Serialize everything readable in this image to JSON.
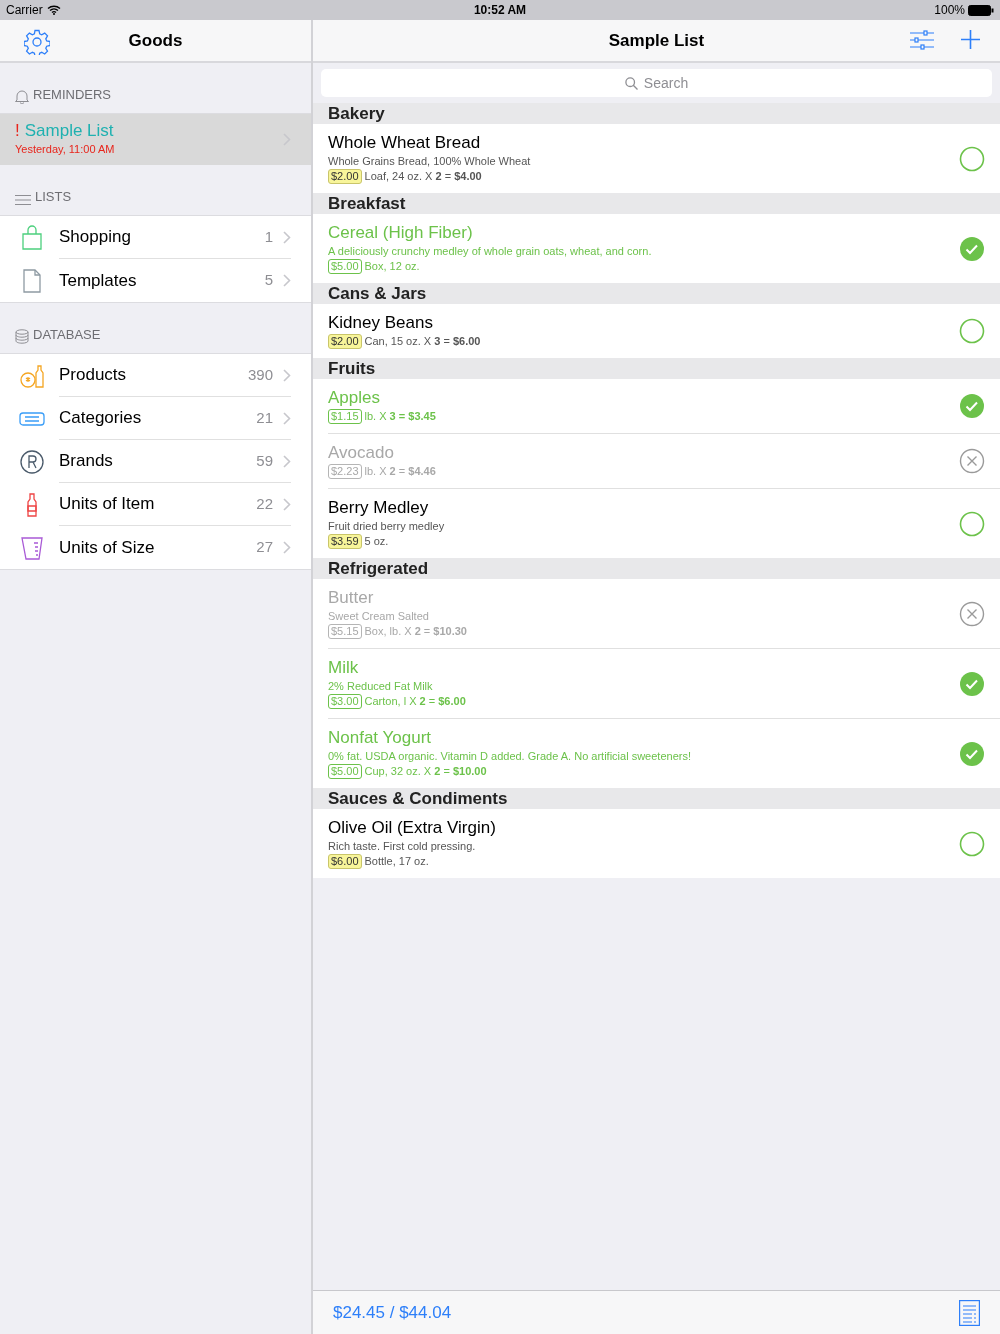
{
  "status_bar": {
    "carrier": "Carrier",
    "time": "10:52 AM",
    "battery": "100%"
  },
  "sidebar": {
    "title": "Goods",
    "reminders": {
      "header": "REMINDERS",
      "items": [
        {
          "mark": "!",
          "title": "Sample List",
          "time": "Yesterday, 11:00 AM",
          "selected": true
        }
      ]
    },
    "lists": {
      "header": "LISTS",
      "items": [
        {
          "kind": "shopping",
          "label": "Shopping",
          "count": "1"
        },
        {
          "kind": "templates",
          "label": "Templates",
          "count": "5"
        }
      ]
    },
    "database": {
      "header": "DATABASE",
      "items": [
        {
          "kind": "products",
          "label": "Products",
          "count": "390"
        },
        {
          "kind": "categories",
          "label": "Categories",
          "count": "21"
        },
        {
          "kind": "brands",
          "label": "Brands",
          "count": "59"
        },
        {
          "kind": "units-item",
          "label": "Units of Item",
          "count": "22"
        },
        {
          "kind": "units-size",
          "label": "Units of Size",
          "count": "27"
        }
      ]
    }
  },
  "list": {
    "title": "Sample List",
    "search": {
      "placeholder": "Search"
    },
    "sections": [
      {
        "title": "Bakery",
        "items": [
          {
            "kind": "open",
            "name": "Whole Wheat Bread",
            "description": "Whole Grains Bread, 100% Whole Wheat",
            "price": "$2.00",
            "detail": "Loaf, 24 oz. X **2** = **$4.00**"
          }
        ]
      },
      {
        "title": "Breakfast",
        "items": [
          {
            "kind": "done",
            "name": "Cereal (High Fiber)",
            "description": "A deliciously crunchy medley of whole grain oats, wheat, and corn.",
            "price": "$5.00",
            "detail": "Box, 12 oz."
          }
        ]
      },
      {
        "title": "Cans & Jars",
        "items": [
          {
            "kind": "open",
            "name": "Kidney Beans",
            "price": "$2.00",
            "detail": "Can, 15 oz. X **3** = **$6.00**"
          }
        ]
      },
      {
        "title": "Fruits",
        "items": [
          {
            "kind": "done",
            "name": "Apples",
            "price": "$1.15",
            "detail": "lb. X **3 = $3.45**"
          },
          {
            "kind": "skipped",
            "name": "Avocado",
            "price": "$2.23",
            "detail": "lb. X **2** = **$4.46**"
          },
          {
            "kind": "open",
            "name": "Berry Medley",
            "description": "Fruit dried berry medley",
            "price": "$3.59",
            "detail": "5 oz."
          }
        ]
      },
      {
        "title": "Refrigerated",
        "items": [
          {
            "kind": "skipped",
            "name": "Butter",
            "description": "Sweet Cream Salted",
            "price": "$5.15",
            "detail": "Box, lb. X **2** = **$10.30**"
          },
          {
            "kind": "done",
            "name": "Milk",
            "description": "2% Reduced Fat Milk",
            "price": "$3.00",
            "detail": "Carton, l X **2** = **$6.00**"
          },
          {
            "kind": "done",
            "name": "Nonfat Yogurt",
            "description": "0% fat. USDA organic. Vitamin D added. Grade A. No artificial sweeteners!",
            "price": "$5.00",
            "detail": "Cup, 32 oz. X **2** = **$10.00**"
          }
        ]
      },
      {
        "title": "Sauces & Condiments",
        "items": [
          {
            "kind": "open",
            "name": "Olive Oil (Extra Virgin)",
            "description": "Rich taste. First cold pressing.",
            "price": "$6.00",
            "detail": "Bottle, 17 oz."
          }
        ]
      }
    ],
    "total": "$24.45 / $44.04"
  }
}
